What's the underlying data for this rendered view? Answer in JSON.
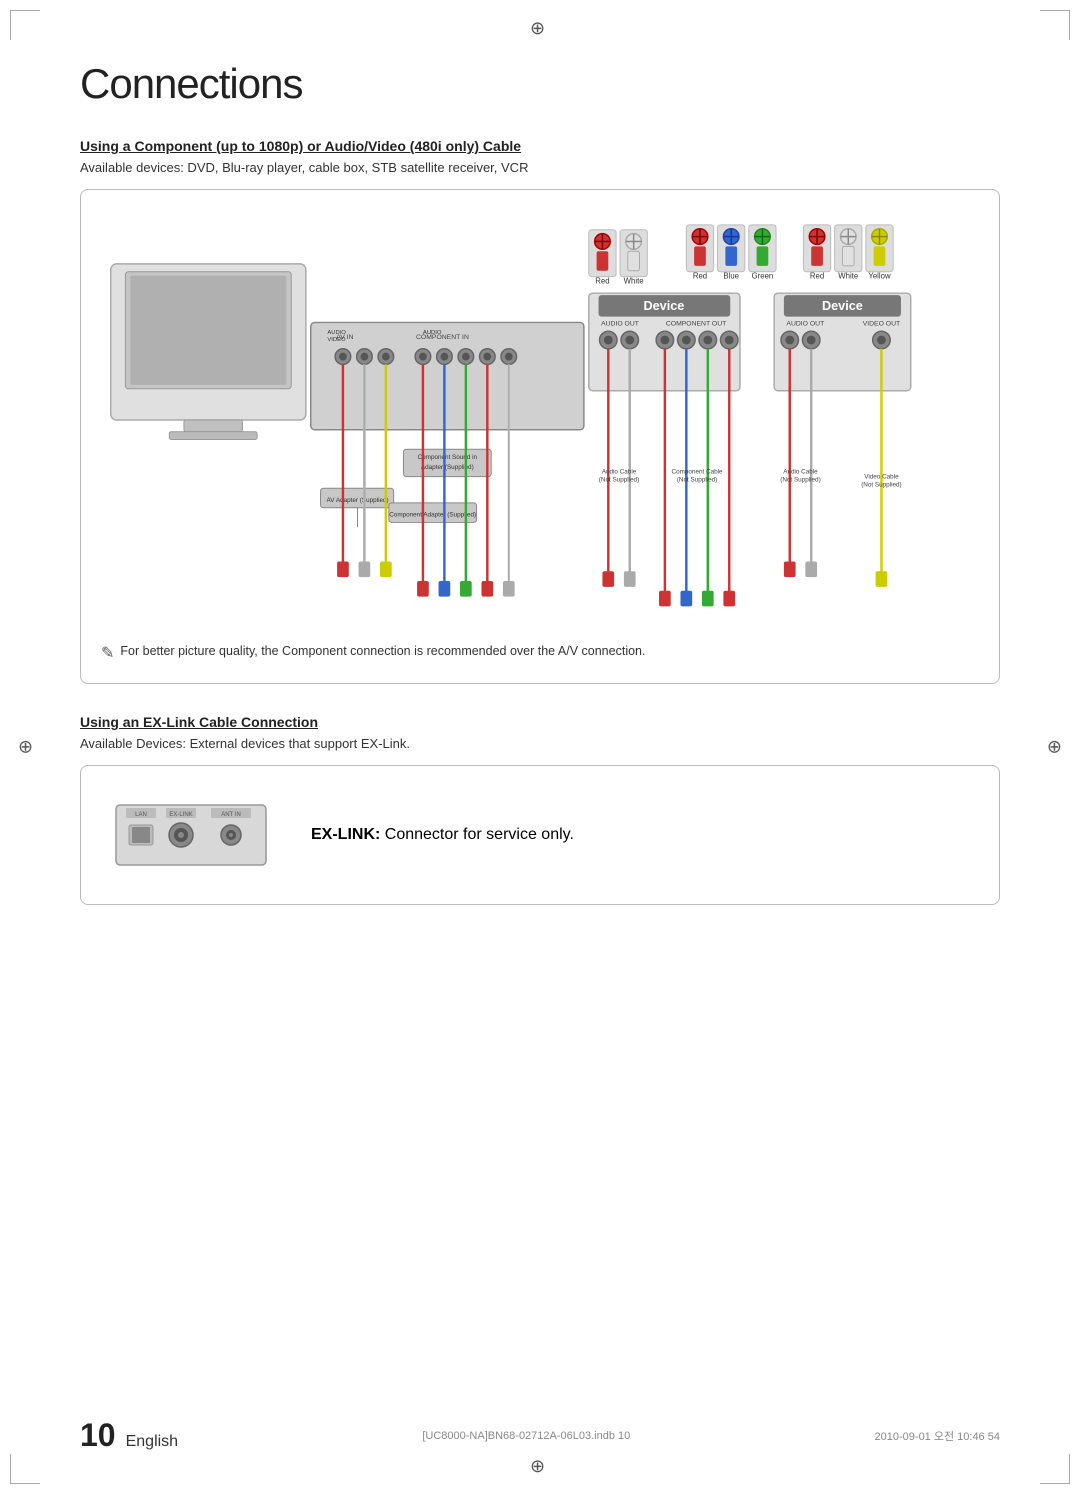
{
  "page": {
    "title": "Connections",
    "corner_symbol": "⊕"
  },
  "section1": {
    "title": "Using a Component (up to 1080p) or Audio/Video (480i only) Cable",
    "subtitle": "Available devices: DVD, Blu-ray player, cable box, STB satellite receiver, VCR",
    "note": "For better picture quality, the Component connection is recommended over the A/V connection."
  },
  "section2": {
    "title": "Using an EX-Link Cable Connection",
    "subtitle": "Available Devices: External devices that support EX-Link.",
    "exlink_label": "EX-LINK:",
    "exlink_desc": "Connector for service only."
  },
  "connectors": {
    "group1": [
      "Red",
      "White"
    ],
    "group2": [
      "Red",
      "Blue",
      "Green"
    ],
    "group3": [
      "Red",
      "White",
      "Yellow"
    ],
    "device1_title": "Device",
    "device1_outputs": [
      "AUDIO OUT",
      "COMPONENT OUT"
    ],
    "device2_title": "Device",
    "device2_outputs": [
      "AUDIO OUT",
      "VIDEO OUT"
    ],
    "labels": {
      "component_sound_in": "Component Sound in\nAdapter (Supplied)",
      "av_adapter": "AV Adapter (Supplied)",
      "component_adapter": "Component Adapter (Supplied)",
      "audio_cable_ns": "Audio Cable\n(Not Supplied)",
      "component_cable_ns": "Component Cable\n(Not Supplied)",
      "audio_cable_ns2": "Audio Cable\n(Not Supplied)",
      "video_cable_ns": "Video Cable\n(Not Supplied)"
    }
  },
  "footer": {
    "page_number": "10",
    "language": "English",
    "file_info": "[UC8000-NA]BN68-02712A-06L03.indb  10",
    "date_info": "2010-09-01   오전 10:46  54"
  }
}
